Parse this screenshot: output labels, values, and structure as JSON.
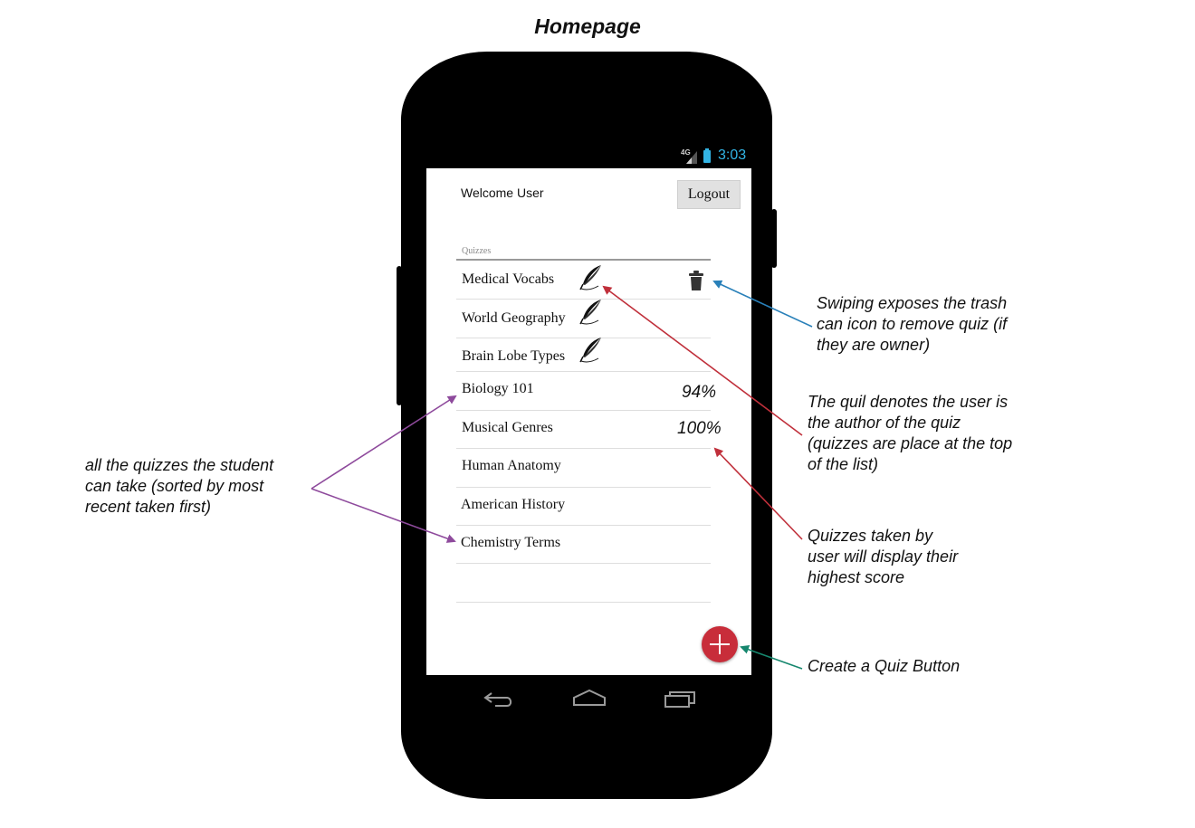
{
  "page": {
    "title": "Homepage"
  },
  "status_bar": {
    "network": "4G",
    "time": "3:03"
  },
  "header": {
    "welcome_text": "Welcome User",
    "logout_label": "Logout"
  },
  "quizzes": {
    "section_label": "Quizzes",
    "items": [
      {
        "label": "Medical Vocabs",
        "author": true,
        "trash": true,
        "score": ""
      },
      {
        "label": "World Geography",
        "author": true,
        "trash": false,
        "score": ""
      },
      {
        "label": "Brain Lobe Types",
        "author": true,
        "trash": false,
        "score": ""
      },
      {
        "label": "Biology 101",
        "author": false,
        "trash": false,
        "score": "94%"
      },
      {
        "label": "Musical Genres",
        "author": false,
        "trash": false,
        "score": "100%"
      },
      {
        "label": "Human Anatomy",
        "author": false,
        "trash": false,
        "score": ""
      },
      {
        "label": "American History",
        "author": false,
        "trash": false,
        "score": ""
      },
      {
        "label": "Chemistry Terms",
        "author": false,
        "trash": false,
        "score": ""
      }
    ]
  },
  "fab": {
    "icon": "plus-icon",
    "color": "#c82d3a"
  },
  "nav_bar": {
    "icons": [
      "back-icon",
      "home-icon",
      "recent-apps-icon"
    ]
  },
  "annotations": {
    "trash": "Swiping exposes the trash\ncan icon to remove quiz (if\nthey are owner)",
    "quill": "The quil denotes the user is\nthe author of  the quiz\n(quizzes are place at the top\nof the list)",
    "score": "Quizzes taken by\nuser will display their\nhighest score",
    "fab": "Create a Quiz Button",
    "list": "all the quizzes the student\ncan take (sorted by most\nrecent taken first)"
  },
  "colors": {
    "trash_arrow": "#2980b9",
    "quill_arrow": "#c0303b",
    "fab_arrow": "#16876e",
    "list_arrow": "#8e4a9c",
    "status_accent": "#33b5e5"
  }
}
